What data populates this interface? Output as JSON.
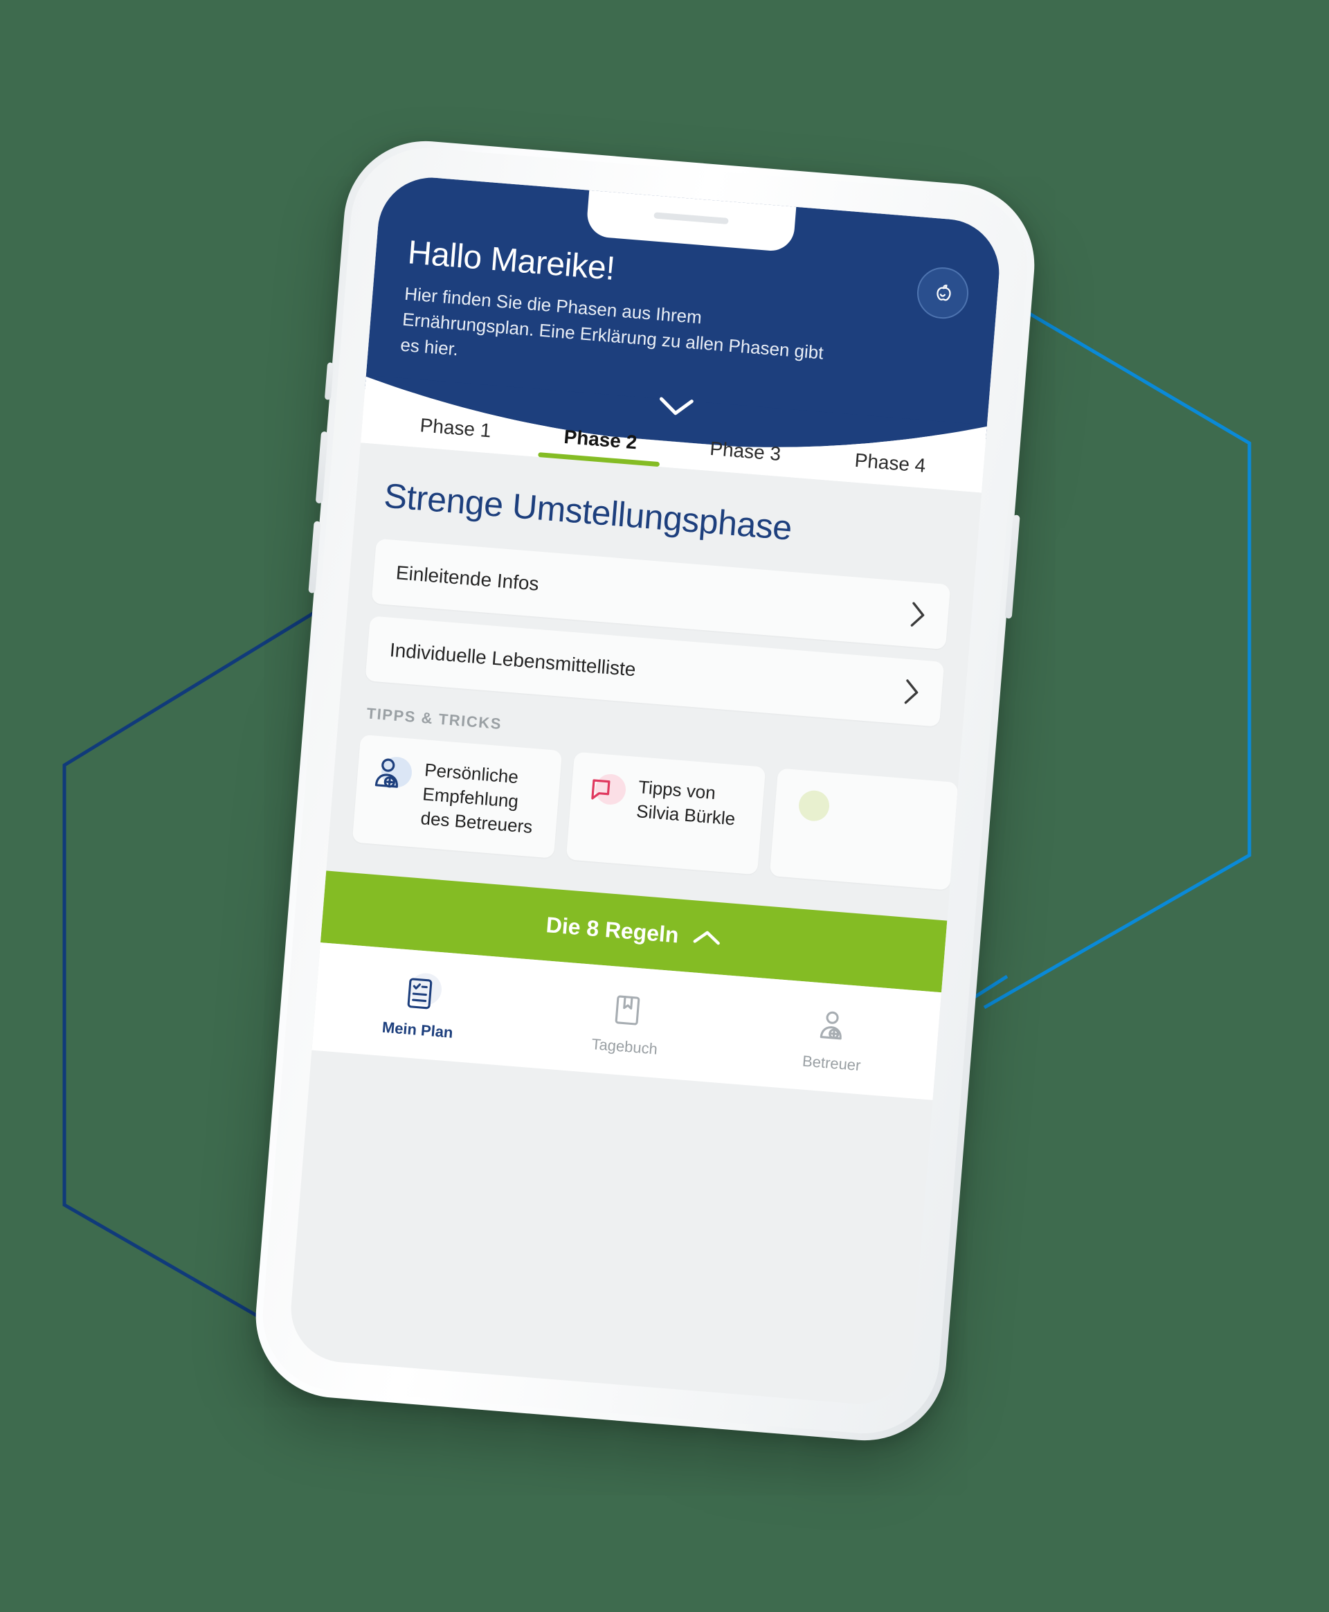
{
  "background_color": "#3e6b4e",
  "decor": {
    "hex_outline_left_color": "#103a7a",
    "hex_outline_right_color": "#0a8ad8",
    "diagonal_line_color": "#0a8ad8"
  },
  "app": {
    "header": {
      "background_color": "#1d3f7d",
      "greeting": "Hallo Mareike!",
      "subtitle": "Hier finden Sie die Phasen aus Ihrem Ernährungsplan. Eine Erklärung zu allen Phasen gibt es hier.",
      "avatar_icon": "apple-icon",
      "expand_icon": "chevron-down-icon"
    },
    "tabs": [
      {
        "label": "Phase 1",
        "active": false
      },
      {
        "label": "Phase 2",
        "active": true
      },
      {
        "label": "Phase 3",
        "active": false
      },
      {
        "label": "Phase 4",
        "active": false
      }
    ],
    "active_tab_underline_color": "#84bc24",
    "content": {
      "phase_title": "Strenge Umstellungsphase",
      "phase_title_color": "#1d3f7d",
      "rows": [
        {
          "label": "Einleitende Infos",
          "chevron": "chevron-right-icon"
        },
        {
          "label": "Individuelle Lebensmittelliste",
          "chevron": "chevron-right-icon"
        }
      ],
      "tips_section_label": "TIPPS & TRICKS",
      "tips_cards": [
        {
          "icon": "person-plus-icon",
          "icon_bg": "#dbe6f5",
          "text": "Persönliche Empfehlung des Betreuers"
        },
        {
          "icon": "speech-bubble-icon",
          "icon_bg": "#fbdfe6",
          "text": "Tipps von Silvia Bürkle"
        },
        {
          "icon": "leaf-icon",
          "icon_bg": "#e8f0cf",
          "text": ""
        }
      ]
    },
    "cta": {
      "label": "Die 8 Regeln",
      "icon": "chevron-up-icon",
      "background_color": "#84bc24"
    },
    "bottom_nav": [
      {
        "label": "Mein Plan",
        "icon": "checklist-document-icon",
        "active": true
      },
      {
        "label": "Tagebuch",
        "icon": "book-bookmark-icon",
        "active": false
      },
      {
        "label": "Betreuer",
        "icon": "person-plus-icon",
        "active": false
      }
    ]
  }
}
